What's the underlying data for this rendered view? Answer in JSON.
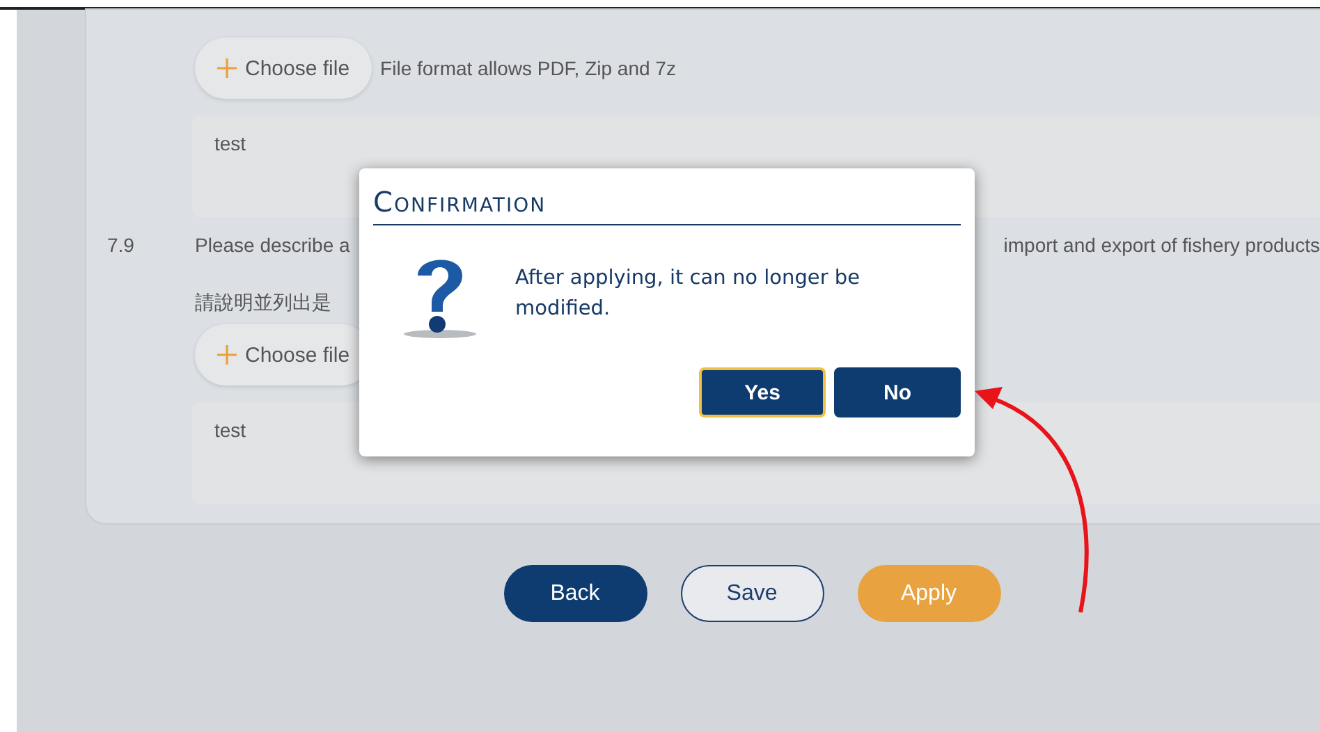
{
  "form": {
    "rows": [
      {
        "kind": "upload",
        "button": "Choose file",
        "hint": "File format allows PDF, Zip and 7z"
      },
      {
        "kind": "textarea",
        "value": "test"
      },
      {
        "kind": "question",
        "number": "7.9",
        "text_start": "Please describe a",
        "text_end": "import and export of fishery products"
      },
      {
        "kind": "question_zh",
        "text": "請說明並列出是"
      },
      {
        "kind": "upload",
        "button": "Choose file"
      },
      {
        "kind": "textarea",
        "value": "test"
      }
    ]
  },
  "actions": [
    {
      "label": "Back",
      "kind": "primary"
    },
    {
      "label": "Save",
      "kind": "outline"
    },
    {
      "label": "Apply",
      "kind": "accent"
    }
  ],
  "dialog": {
    "title": "Confirmation",
    "message": "After applying, it can no longer be modified.",
    "buttons": [
      {
        "label": "Yes",
        "focused": true
      },
      {
        "label": "No",
        "focused": false
      }
    ]
  }
}
